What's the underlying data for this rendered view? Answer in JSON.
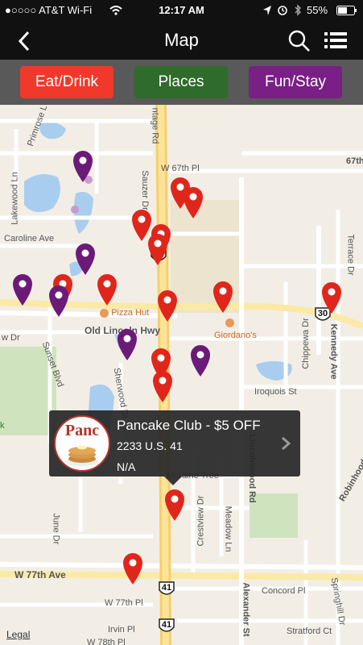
{
  "status_bar": {
    "carrier": "●○○○○ AT&T Wi-Fi",
    "time": "12:17 AM",
    "battery": "55%"
  },
  "nav": {
    "title": "Map",
    "back_icon": "chevron-left-icon",
    "search_icon": "search-icon",
    "list_icon": "list-icon"
  },
  "filters": [
    {
      "label": "Eat/Drink",
      "color": "#f0392b"
    },
    {
      "label": "Places",
      "color": "#2f6b2a"
    },
    {
      "label": "Fun/Stay",
      "color": "#7a1f86"
    }
  ],
  "map": {
    "streets": {
      "w67th": "W 67th Pl",
      "r67th": "67th",
      "caroline": "Caroline Ave",
      "lakewood": "Lakewood Ln",
      "primrose": "Primrose L",
      "frontage": "ntage Rd",
      "sauzer": "Sauzer Dr",
      "oldlincoln": "Old Lincoln Hwy",
      "sunset": "Sunset Blvd",
      "w_dr": "w Dr",
      "sherwood": "Sherwood Dr",
      "iroquois": "Iroquois St",
      "chippewa": "Chippewa Dr",
      "kennedy": "Kennedy Ave",
      "terrace": "Terrace Dr",
      "lincolnwood": "Lincolnwood Rd",
      "moraine": "Moraine Tree",
      "crestview": "Crestview Dr",
      "meadow": "Meadow Ln",
      "june": "June Dr",
      "w77th": "W 77th Ave",
      "w77thpl": "W 77th Pl",
      "irvin": "Irvin Pl",
      "w78th": "W 78th Pl",
      "alexander": "Alexander St",
      "concord": "Concord Pl",
      "springhill": "Springhill Dr",
      "stratford": "Stratford Ct",
      "robinhood": "Robinhood",
      "k": "k"
    },
    "pois": {
      "pizza_hut": "Pizza Hut",
      "giordanos": "Giordano's"
    },
    "shields": {
      "us41_top": "41",
      "us41_mid": "41",
      "us41_bot": "41",
      "us30": "30"
    },
    "legal": "Legal"
  },
  "callout": {
    "logo_text": "Panc",
    "title": "Pancake Club - $5 OFF",
    "address": "2233 U.S. 41",
    "extra": "N/A",
    "chevron_icon": "chevron-right-icon"
  }
}
